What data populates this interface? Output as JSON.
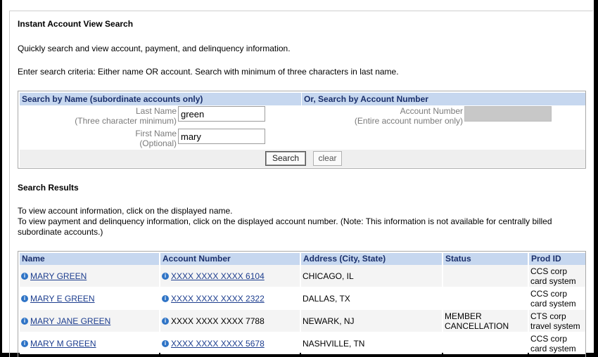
{
  "page": {
    "title": "Instant Account View Search",
    "description": "Quickly search and view account, payment, and delinquency information.",
    "criteria_note": "Enter search criteria: Either name OR account. Search with minimum of three characters in last name."
  },
  "search": {
    "by_name_header": "Search by Name (subordinate accounts only)",
    "by_account_header": "Or, Search by Account Number",
    "last_name_label": "Last Name",
    "last_name_hint": "(Three character minimum)",
    "last_name_value": "green",
    "first_name_label": "First Name",
    "first_name_hint": "(Optional)",
    "first_name_value": "mary",
    "account_label": "Account Number",
    "account_hint": "(Entire account number only)",
    "account_value": "",
    "search_button": "Search",
    "clear_button": "clear"
  },
  "results": {
    "title": "Search Results",
    "info_line1": "To view account information, click on the displayed name.",
    "info_line2": "To view payment and delinquency information, click on the displayed account number. (Note: This information is not available for centrally billed subordinate accounts.)",
    "columns": [
      "Name",
      "Account Number",
      "Address (City, State)",
      "Status",
      "Prod ID"
    ],
    "rows": [
      {
        "name": "MARY GREEN",
        "account": "XXXX XXXX XXXX 6104",
        "account_link": true,
        "address": "CHICAGO, IL",
        "status": "",
        "prod": "CCS corp card system"
      },
      {
        "name": "MARY E GREEN",
        "account": "XXXX XXXX XXXX 2322",
        "account_link": true,
        "address": "DALLAS, TX",
        "status": "",
        "prod": "CCS corp card system"
      },
      {
        "name": "MARY JANE GREEN",
        "account": "XXXX XXXX XXXX 7788",
        "account_link": false,
        "address": "NEWARK, NJ",
        "status": "MEMBER CANCELLATION",
        "prod": "CTS corp travel system"
      },
      {
        "name": "MARY M GREEN",
        "account": "XXXX XXXX XXXX 5678",
        "account_link": true,
        "address": "NASHVILLE, TN",
        "status": "",
        "prod": "CCS corp card system"
      }
    ]
  },
  "colors": {
    "header_bg": "#c6d7ef",
    "header_text": "#1a2f6b",
    "link": "#1c3d8e",
    "info_icon": "#2f74c6"
  },
  "icons": {
    "info": "info-icon"
  }
}
